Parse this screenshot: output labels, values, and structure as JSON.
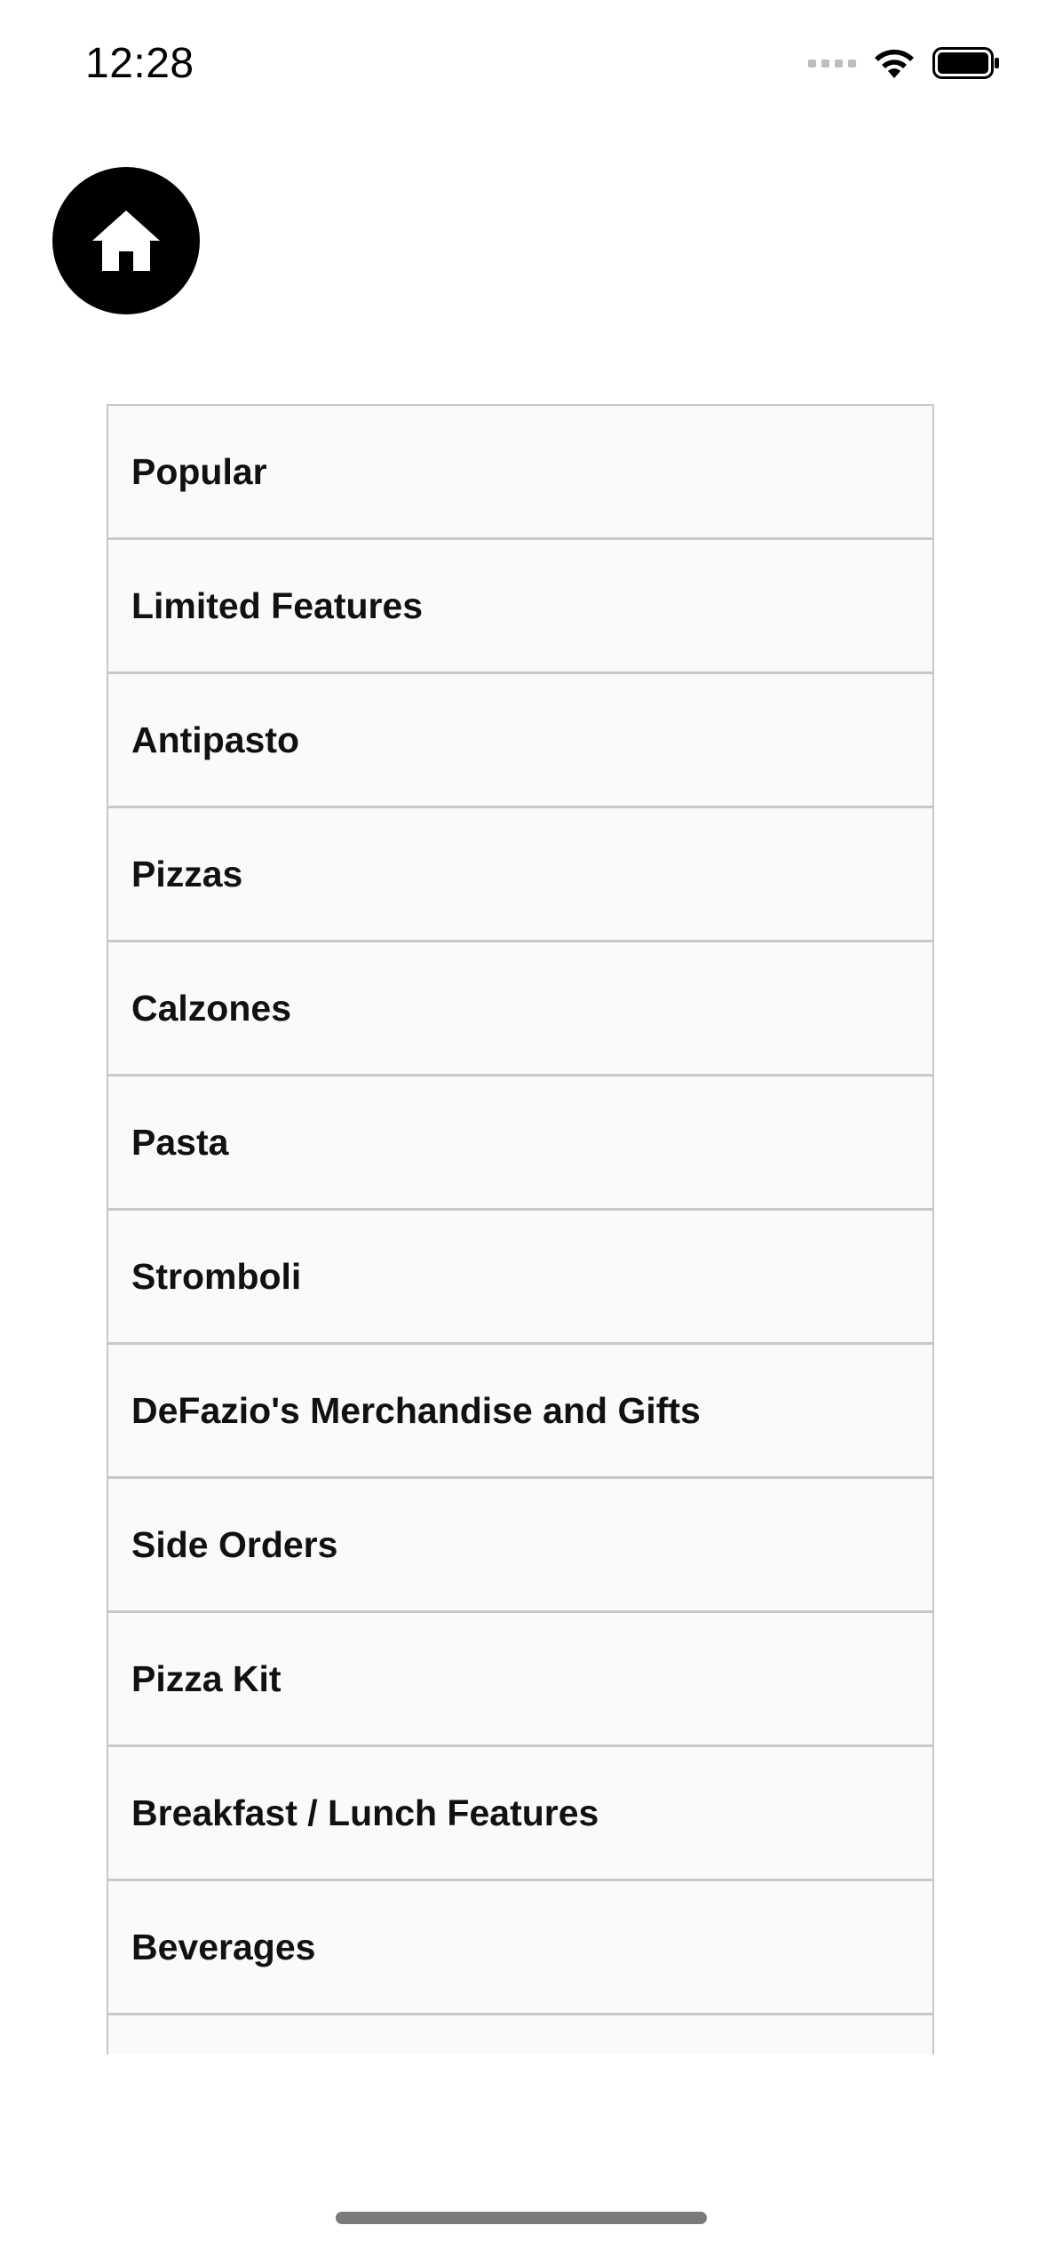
{
  "status_bar": {
    "time": "12:28"
  },
  "header": {
    "home_icon": "house-icon"
  },
  "categories": [
    {
      "label": "Popular"
    },
    {
      "label": "Limited Features"
    },
    {
      "label": "Antipasto"
    },
    {
      "label": "Pizzas"
    },
    {
      "label": "Calzones"
    },
    {
      "label": "Pasta"
    },
    {
      "label": "Stromboli"
    },
    {
      "label": "DeFazio's Merchandise and Gifts"
    },
    {
      "label": "Side Orders"
    },
    {
      "label": "Pizza Kit"
    },
    {
      "label": "Breakfast / Lunch Features"
    },
    {
      "label": "Beverages"
    },
    {
      "label": ""
    }
  ],
  "colors": {
    "row_background": "#fafafa",
    "row_border": "#c8c8c8",
    "home_button": "#000000"
  }
}
